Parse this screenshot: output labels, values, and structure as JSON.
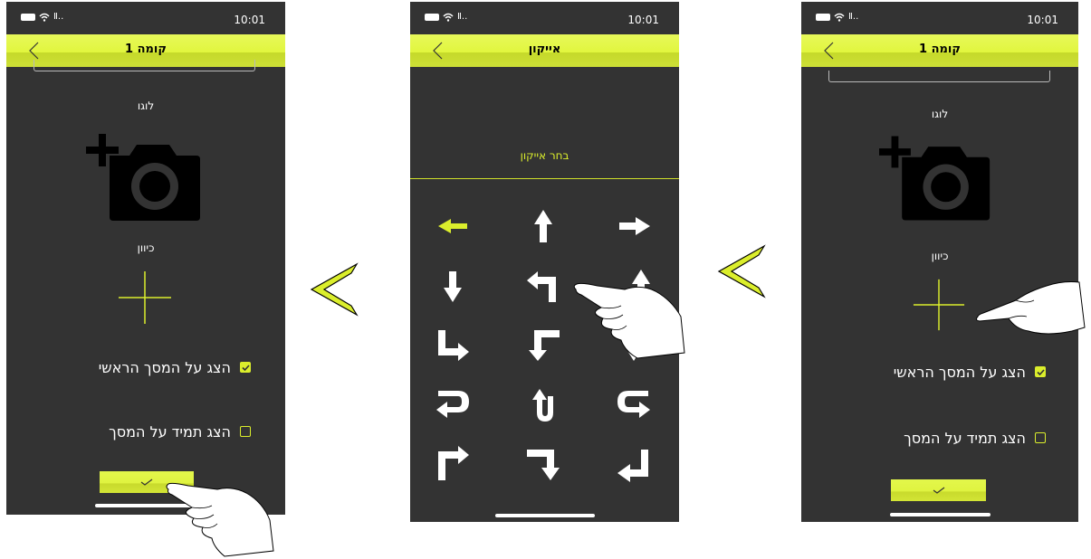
{
  "status_bar": {
    "time": "10:01",
    "bars": "Ⅱ.."
  },
  "left_screen": {
    "title": "קומה 1",
    "logo_label": "לוגו",
    "direction_label": "כיוון",
    "show_main_label": "הצג על המסך הראשי",
    "show_main_checked": true,
    "show_always_label": "הצג תמיד על המסך",
    "show_always_checked": false
  },
  "middle_screen": {
    "title": "אייקון",
    "choose_label": "בחר אייקון",
    "icons": [
      "arrow-left-icon",
      "arrow-up-icon",
      "arrow-right-icon",
      "arrow-down-icon",
      "turn-left-icon",
      "arrow-up-icon",
      "turn-down-right-icon",
      "turn-down-left-icon",
      "arrow-down-icon",
      "u-turn-left-icon",
      "u-turn-up-icon",
      "u-turn-right-icon",
      "turn-up-right-icon",
      "turn-right-down-icon",
      "return-left-icon"
    ],
    "selected_icon_index": 0
  },
  "right_screen": {
    "title": "קומה 1",
    "logo_label": "לוגו",
    "direction_label": "כיוון",
    "show_main_label": "הצג על המסך הראשי",
    "show_main_checked": true,
    "show_always_label": "הצג תמיד על המסך",
    "show_always_checked": false
  },
  "colors": {
    "accent": "#dbee2c",
    "background": "#333333",
    "header": "#e1f63e"
  }
}
